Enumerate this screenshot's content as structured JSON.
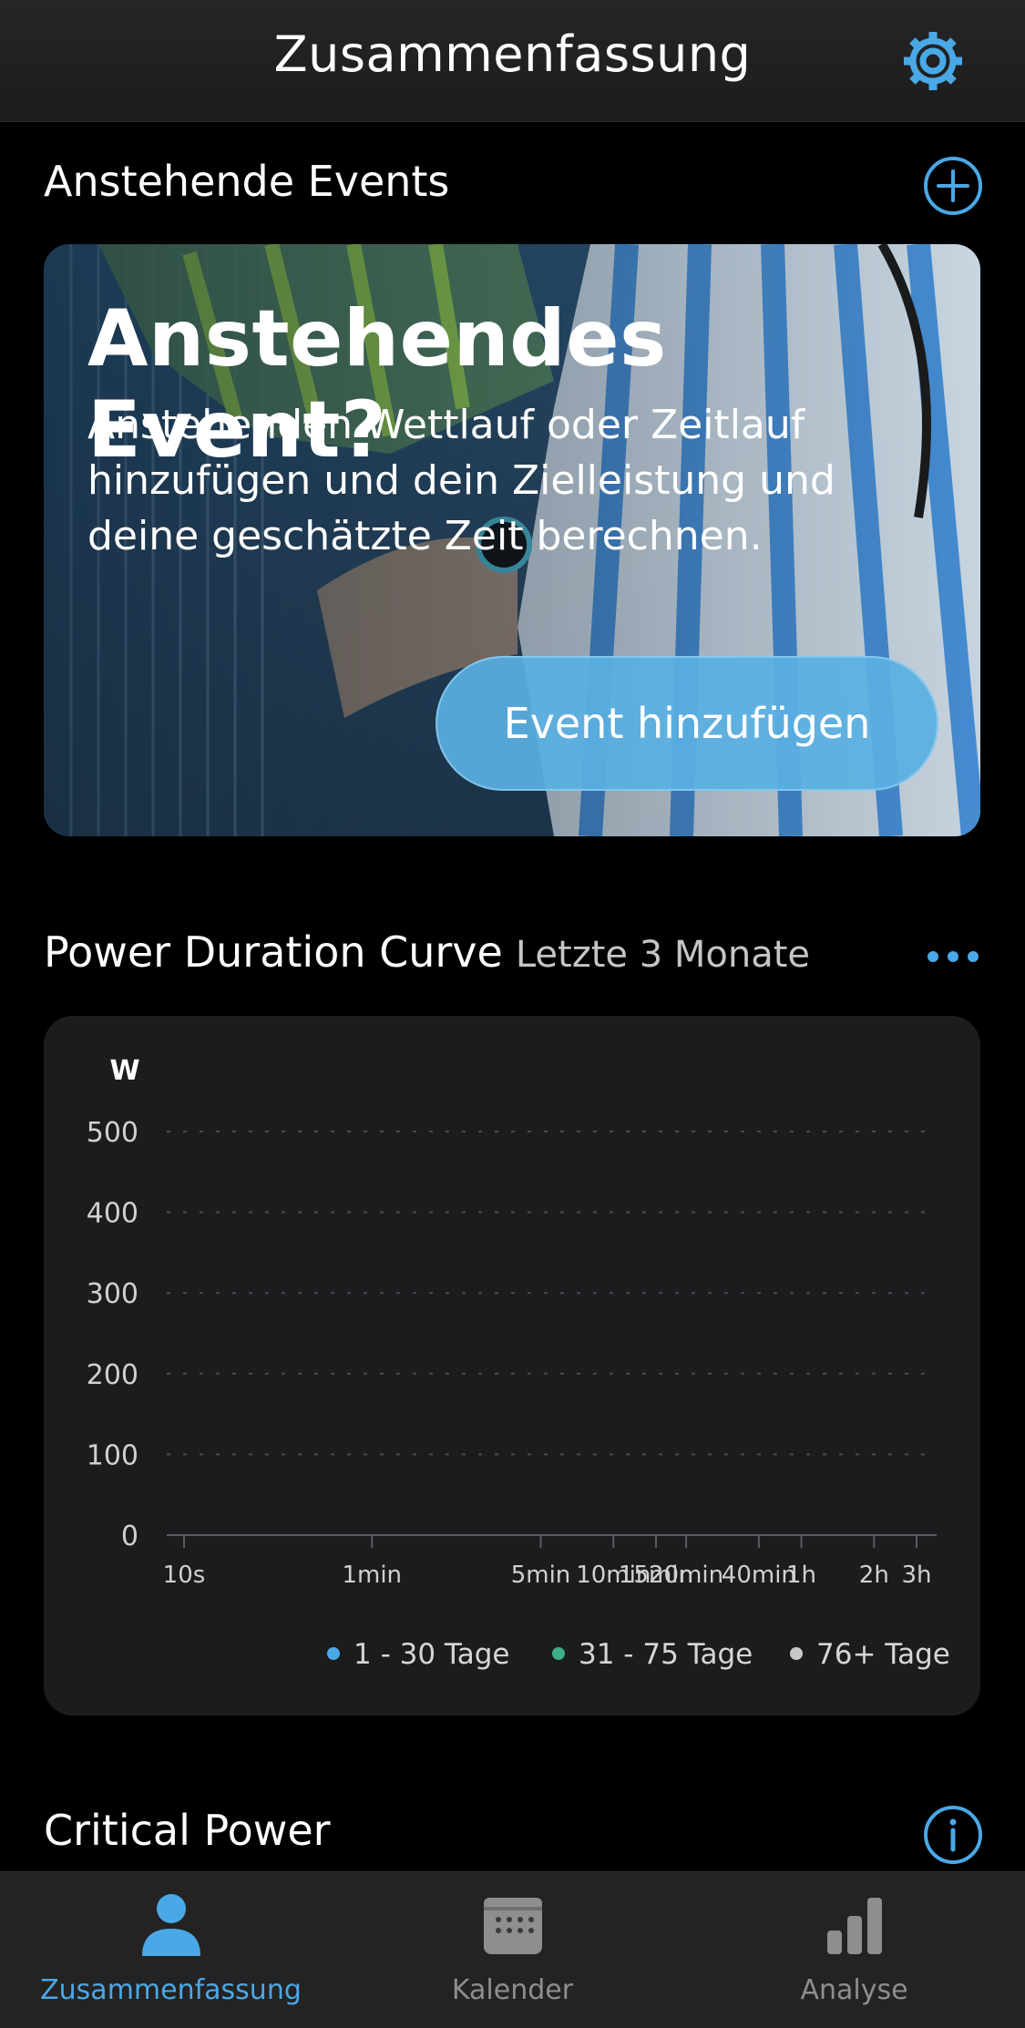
{
  "header": {
    "title": "Zusammenfassung",
    "settings_icon": "gear-icon"
  },
  "events_section": {
    "title": "Anstehende Events",
    "add_icon": "plus-circle-icon",
    "card": {
      "headline": "Anstehendes Event?",
      "description": "Anstehenden Wettlauf oder Zeitlauf hinzufügen und dein Zielleistung und deine geschätzte Zeit berechnen.",
      "button_label": "Event hinzufügen"
    }
  },
  "pdc_section": {
    "title": "Power Duration Curve",
    "subtitle": "Letzte 3 Monate",
    "more_icon": "more-dots-icon"
  },
  "chart_data": {
    "type": "line",
    "ylabel": "W",
    "ylim": [
      0,
      500
    ],
    "y_ticks": [
      "0",
      "100",
      "200",
      "300",
      "400",
      "500"
    ],
    "x_ticks": [
      "10s",
      "1min",
      "5min",
      "10min",
      "15min",
      "20min",
      "40min",
      "1h",
      "2h",
      "3h"
    ],
    "x_seconds": [
      10,
      60,
      300,
      600,
      900,
      1200,
      2400,
      3600,
      7200,
      10800
    ],
    "grid": true,
    "legend_position": "bottom-right",
    "series": [
      {
        "name": "1 - 30 Tage",
        "color": "#4aa8e6",
        "values": []
      },
      {
        "name": "31 - 75 Tage",
        "color": "#3fae86",
        "values": []
      },
      {
        "name": "76+ Tage",
        "color": "#c8c8c8",
        "values": []
      }
    ]
  },
  "cp_section": {
    "title": "Critical Power",
    "info_icon": "info-circle-icon"
  },
  "tabbar": {
    "tabs": [
      {
        "label": "Zusammenfassung",
        "icon": "person-icon",
        "active": true
      },
      {
        "label": "Kalender",
        "icon": "calendar-icon",
        "active": false
      },
      {
        "label": "Analyse",
        "icon": "bar-chart-icon",
        "active": false
      }
    ]
  },
  "colors": {
    "accent": "#4aa8e6",
    "inactive": "#8e8e8e",
    "card": "#1b1c1e"
  }
}
